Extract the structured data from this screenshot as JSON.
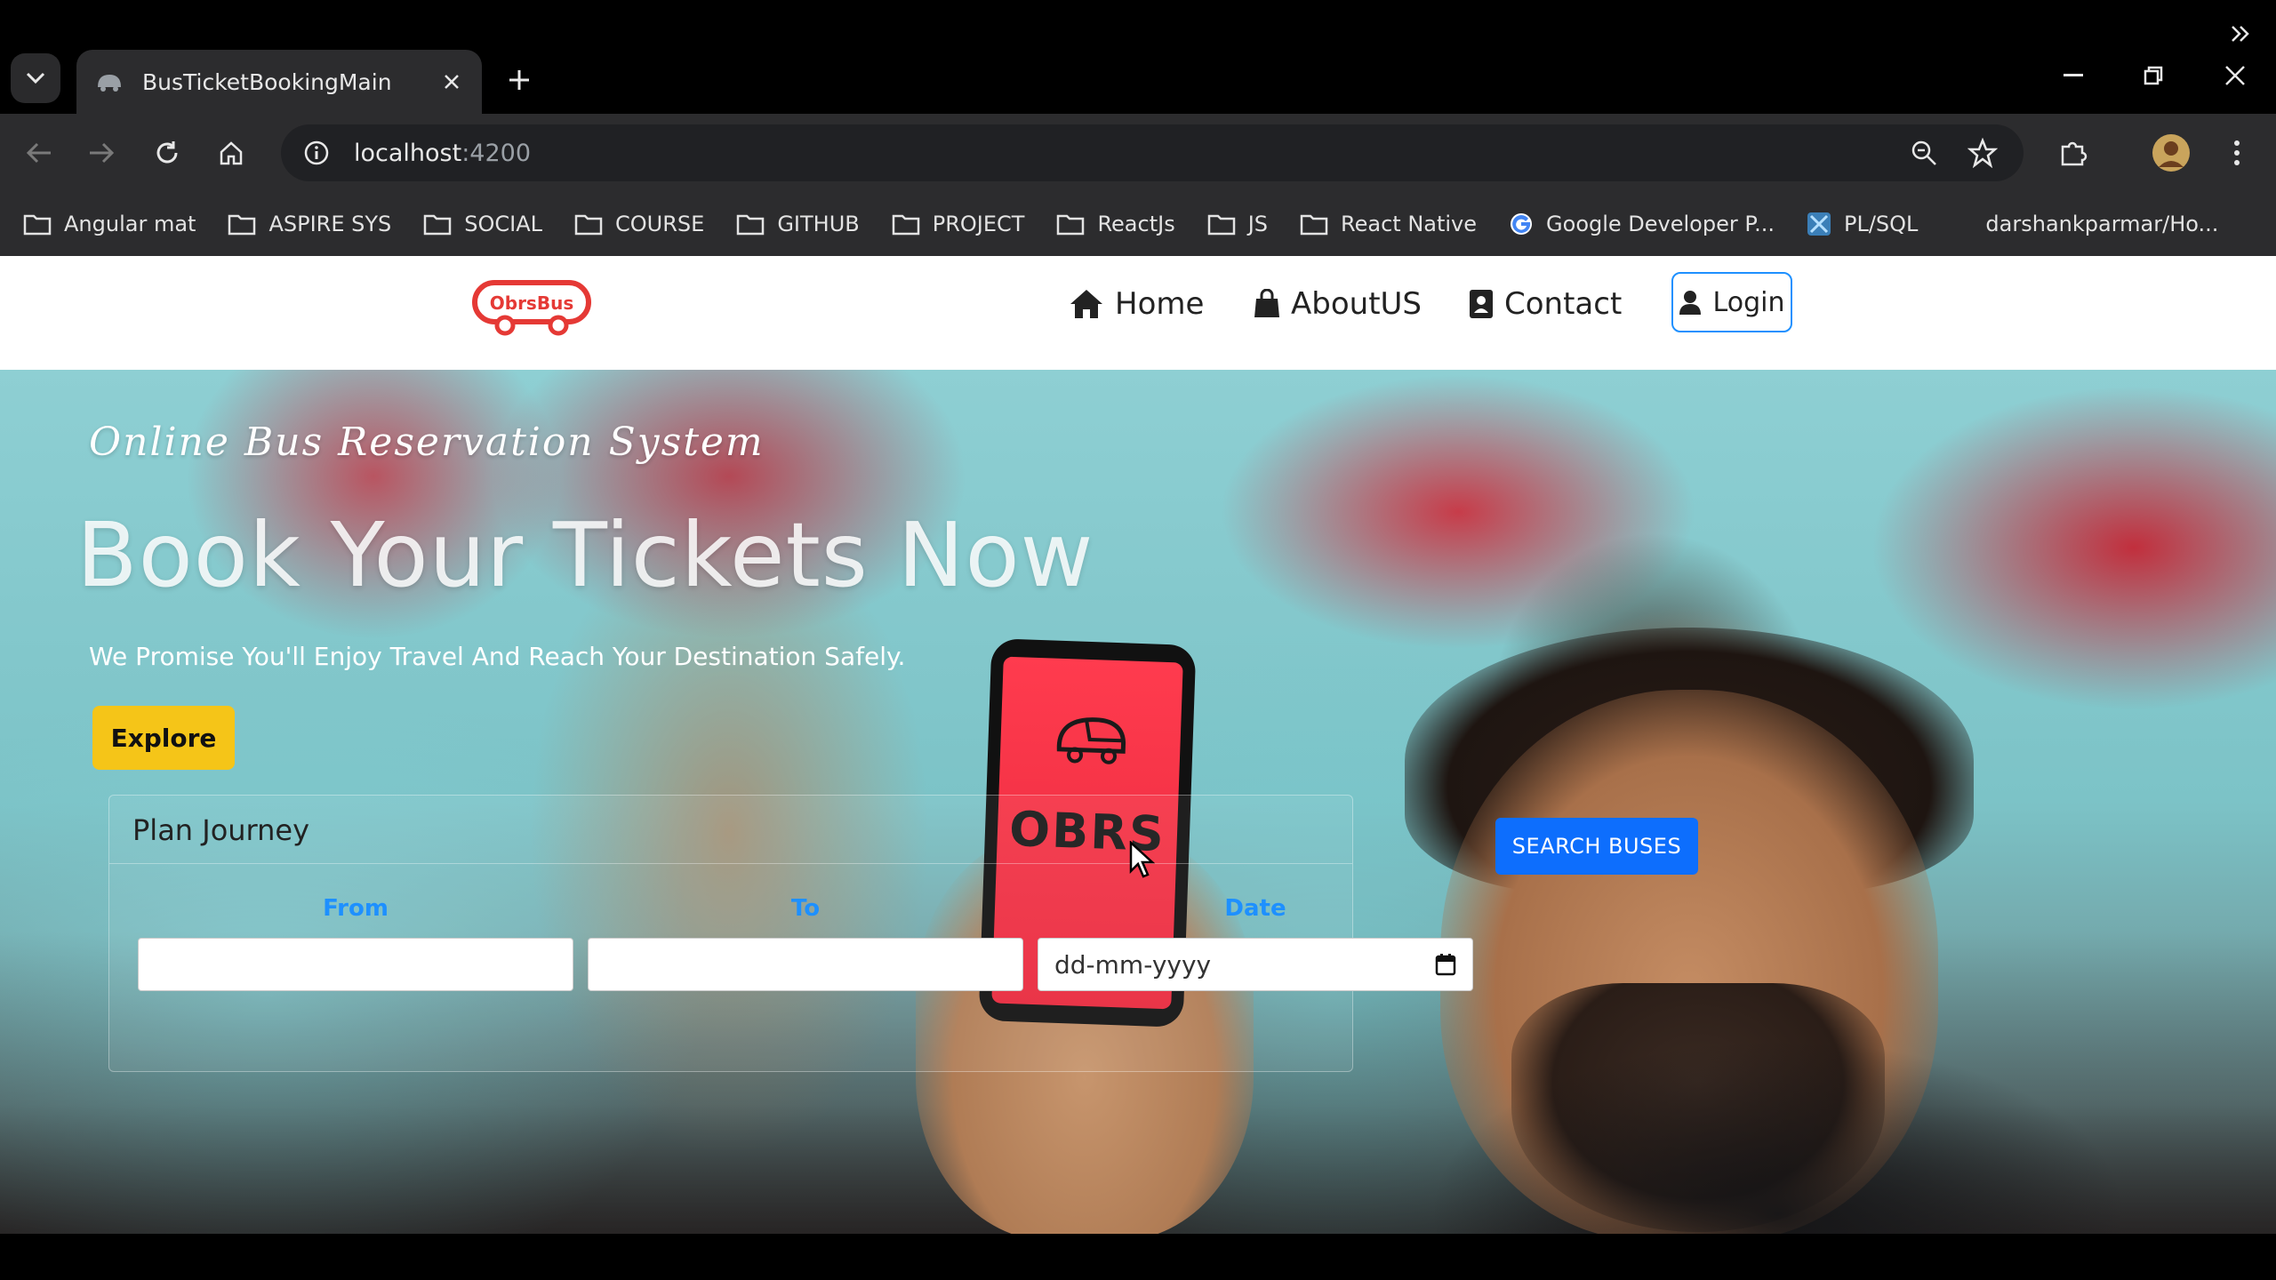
{
  "browser": {
    "tab_title": "BusTicketBookingMain",
    "url_host": "localhost",
    "url_port": ":4200",
    "bookmarks": [
      {
        "label": "Angular mat",
        "icon": "folder-icon"
      },
      {
        "label": "ASPIRE SYS",
        "icon": "folder-icon"
      },
      {
        "label": "SOCIAL",
        "icon": "folder-icon"
      },
      {
        "label": "COURSE",
        "icon": "folder-icon"
      },
      {
        "label": "GITHUB",
        "icon": "folder-icon"
      },
      {
        "label": "PROJECT",
        "icon": "folder-icon"
      },
      {
        "label": "ReactJs",
        "icon": "folder-icon"
      },
      {
        "label": "JS",
        "icon": "folder-icon"
      },
      {
        "label": "React Native",
        "icon": "folder-icon"
      },
      {
        "label": "Google Developer P...",
        "icon": "google-icon"
      },
      {
        "label": "PL/SQL",
        "icon": "plsql-icon"
      },
      {
        "label": "darshankparmar/Ho...",
        "icon": "none"
      }
    ]
  },
  "site": {
    "logo_text": "ObrsBus",
    "nav": {
      "home": "Home",
      "about": "AboutUS",
      "contact": "Contact",
      "login": "Login"
    }
  },
  "hero": {
    "tagline": "Online Bus Reservation System",
    "headline": "Book Your Tickets Now",
    "subline": "We Promise You'll Enjoy Travel And Reach Your Destination Safely.",
    "explore_label": "Explore",
    "phone_brand": "OBRS"
  },
  "plan": {
    "title": "Plan Journey",
    "from_label": "From",
    "to_label": "To",
    "date_label": "Date",
    "from_value": "",
    "to_value": "",
    "date_placeholder": "dd-mm-yyyy",
    "search_label": "SEARCH BUSES"
  },
  "colors": {
    "accent_yellow": "#f5c518",
    "primary_blue": "#0d6efd",
    "label_blue": "#1e90ff",
    "logo_red": "#e53935"
  }
}
